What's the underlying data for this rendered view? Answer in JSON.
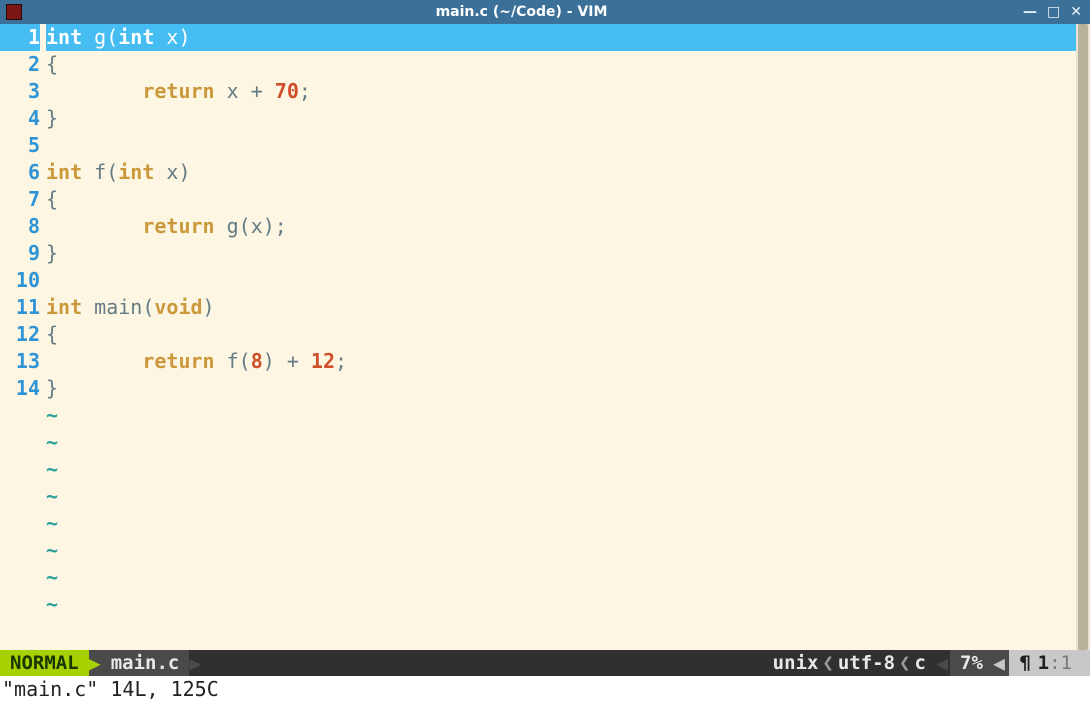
{
  "window": {
    "title": "main.c (~/Code) - VIM",
    "buttons": {
      "min": "—",
      "max": "□",
      "close": "✕"
    }
  },
  "editor": {
    "cursor_line_index": 0,
    "lines": [
      {
        "n": "1",
        "tokens": [
          [
            "kw",
            "int"
          ],
          [
            "plain",
            " g"
          ],
          [
            "plain",
            "("
          ],
          [
            "kw",
            "int"
          ],
          [
            "plain",
            " x)"
          ]
        ]
      },
      {
        "n": "2",
        "tokens": [
          [
            "plain",
            "{"
          ]
        ]
      },
      {
        "n": "3",
        "tokens": [
          [
            "plain",
            "        "
          ],
          [
            "kw",
            "return"
          ],
          [
            "plain",
            " x + "
          ],
          [
            "num",
            "70"
          ],
          [
            "plain",
            ";"
          ]
        ]
      },
      {
        "n": "4",
        "tokens": [
          [
            "plain",
            "}"
          ]
        ]
      },
      {
        "n": "5",
        "tokens": []
      },
      {
        "n": "6",
        "tokens": [
          [
            "kw",
            "int"
          ],
          [
            "plain",
            " f("
          ],
          [
            "kw",
            "int"
          ],
          [
            "plain",
            " x)"
          ]
        ]
      },
      {
        "n": "7",
        "tokens": [
          [
            "plain",
            "{"
          ]
        ]
      },
      {
        "n": "8",
        "tokens": [
          [
            "plain",
            "        "
          ],
          [
            "kw",
            "return"
          ],
          [
            "plain",
            " g(x);"
          ]
        ]
      },
      {
        "n": "9",
        "tokens": [
          [
            "plain",
            "}"
          ]
        ]
      },
      {
        "n": "10",
        "tokens": []
      },
      {
        "n": "11",
        "tokens": [
          [
            "kw",
            "int"
          ],
          [
            "plain",
            " main("
          ],
          [
            "kw",
            "void"
          ],
          [
            "plain",
            ")"
          ]
        ]
      },
      {
        "n": "12",
        "tokens": [
          [
            "plain",
            "{"
          ]
        ]
      },
      {
        "n": "13",
        "tokens": [
          [
            "plain",
            "        "
          ],
          [
            "kw",
            "return"
          ],
          [
            "plain",
            " f("
          ],
          [
            "num",
            "8"
          ],
          [
            "plain",
            ") + "
          ],
          [
            "num",
            "12"
          ],
          [
            "plain",
            ";"
          ]
        ]
      },
      {
        "n": "14",
        "tokens": [
          [
            "plain",
            "}"
          ]
        ]
      }
    ],
    "tilde_rows": 8,
    "tilde": "~"
  },
  "airline": {
    "mode": "NORMAL",
    "file": "main.c",
    "fileformat": "unix",
    "encoding": "utf-8",
    "filetype": "c",
    "percent": "7%",
    "line": "1",
    "col": "1"
  },
  "cmdline": "\"main.c\" 14L, 125C"
}
